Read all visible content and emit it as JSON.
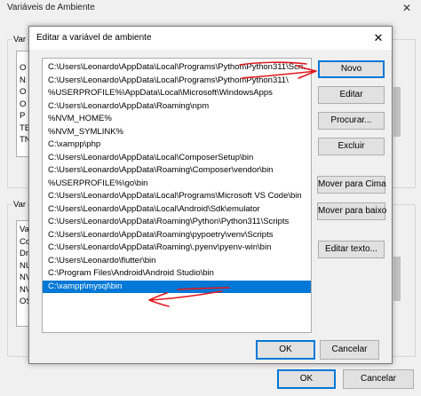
{
  "parent": {
    "title": "Variáveis de Ambiente",
    "close_glyph": "✕",
    "user_group_label": "Var",
    "user_list_items": [
      "O",
      "N",
      "O",
      "O",
      "P",
      "TE",
      "TN"
    ],
    "system_group_label": "Var",
    "system_list_items": [
      "Va",
      "Co",
      "Dr",
      "NU",
      "NV",
      "NV",
      "OS"
    ],
    "ok_label": "OK",
    "cancel_label": "Cancelar"
  },
  "modal": {
    "title": "Editar a variável de ambiente",
    "close_glyph": "✕",
    "variables": [
      "C:\\Users\\Leonardo\\AppData\\Local\\Programs\\Python\\Python311\\Scri...",
      "C:\\Users\\Leonardo\\AppData\\Local\\Programs\\Python\\Python311\\",
      "%USERPROFILE%\\AppData\\Local\\Microsoft\\WindowsApps",
      "C:\\Users\\Leonardo\\AppData\\Roaming\\npm",
      "%NVM_HOME%",
      "%NVM_SYMLINK%",
      "C:\\xampp\\php",
      "C:\\Users\\Leonardo\\AppData\\Local\\ComposerSetup\\bin",
      "C:\\Users\\Leonardo\\AppData\\Roaming\\Composer\\vendor\\bin",
      "%USERPROFILE%\\go\\bin",
      "C:\\Users\\Leonardo\\AppData\\Local\\Programs\\Microsoft VS Code\\bin",
      "C:\\Users\\Leonardo\\AppData\\Local\\Android\\Sdk\\emulator",
      "C:\\Users\\Leonardo\\AppData\\Roaming\\Python\\Python311\\Scripts",
      "C:\\Users\\Leonardo\\AppData\\Roaming\\pypoetry\\venv\\Scripts",
      "C:\\Users\\Leonardo\\AppData\\Roaming\\.pyenv\\pyenv-win\\bin",
      "C:\\Users\\Leonardo\\flutter\\bin",
      "C:\\Program Files\\Android\\Android Studio\\bin",
      "C:\\xampp\\mysql\\bin"
    ],
    "selected_index": 17,
    "buttons": {
      "new": "Novo",
      "edit": "Editar",
      "browse": "Procurar...",
      "delete": "Excluir",
      "move_up": "Mover para Cima",
      "move_down": "Mover para baixo",
      "edit_text": "Editar texto..."
    },
    "ok_label": "OK",
    "cancel_label": "Cancelar"
  },
  "colors": {
    "selection": "#0078d7",
    "annotation": "#e0191e"
  }
}
